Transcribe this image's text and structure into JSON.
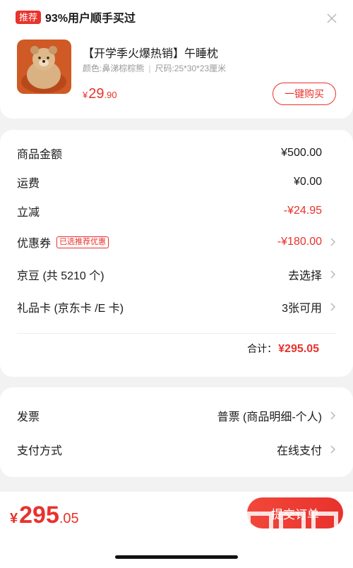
{
  "recommend": {
    "tag": "推荐",
    "title": "93%用户顺手买过",
    "product": {
      "title": "【开学季火爆热销】午睡枕",
      "color_spec": "颜色:鼻涕棕棕熊",
      "size_spec": "尺码:25*30*23厘米",
      "price_symbol": "¥",
      "price_int": "29",
      "price_dec": ".90"
    },
    "buy_button": "一键购买"
  },
  "amounts": {
    "goods_label": "商品金额",
    "goods_value": "¥500.00",
    "shipping_label": "运费",
    "shipping_value": "¥0.00",
    "discount_label": "立减",
    "discount_value": "-¥24.95",
    "coupon_label": "优惠券",
    "coupon_tag": "已选推荐优惠",
    "coupon_value": "-¥180.00",
    "jingdou_label": "京豆 (共 5210 个)",
    "jingdou_value": "去选择",
    "giftcard_label": "礼品卡 (京东卡 /E 卡)",
    "giftcard_value": "3张可用",
    "total_label": "合计：",
    "total_value": "¥295.05"
  },
  "invoice": {
    "invoice_label": "发票",
    "invoice_value": "普票 (商品明细-个人)",
    "payment_label": "支付方式",
    "payment_value": "在线支付"
  },
  "bottom": {
    "price_symbol": "¥",
    "price_int": "295",
    "price_dec": ".05",
    "submit_label": "提交订单"
  },
  "watermark": {
    "site": "zhizhizhi.com"
  },
  "colors": {
    "accent": "#e8322c",
    "background": "#f2f2f2",
    "card": "#ffffff",
    "muted_text": "#9a9a9a"
  }
}
